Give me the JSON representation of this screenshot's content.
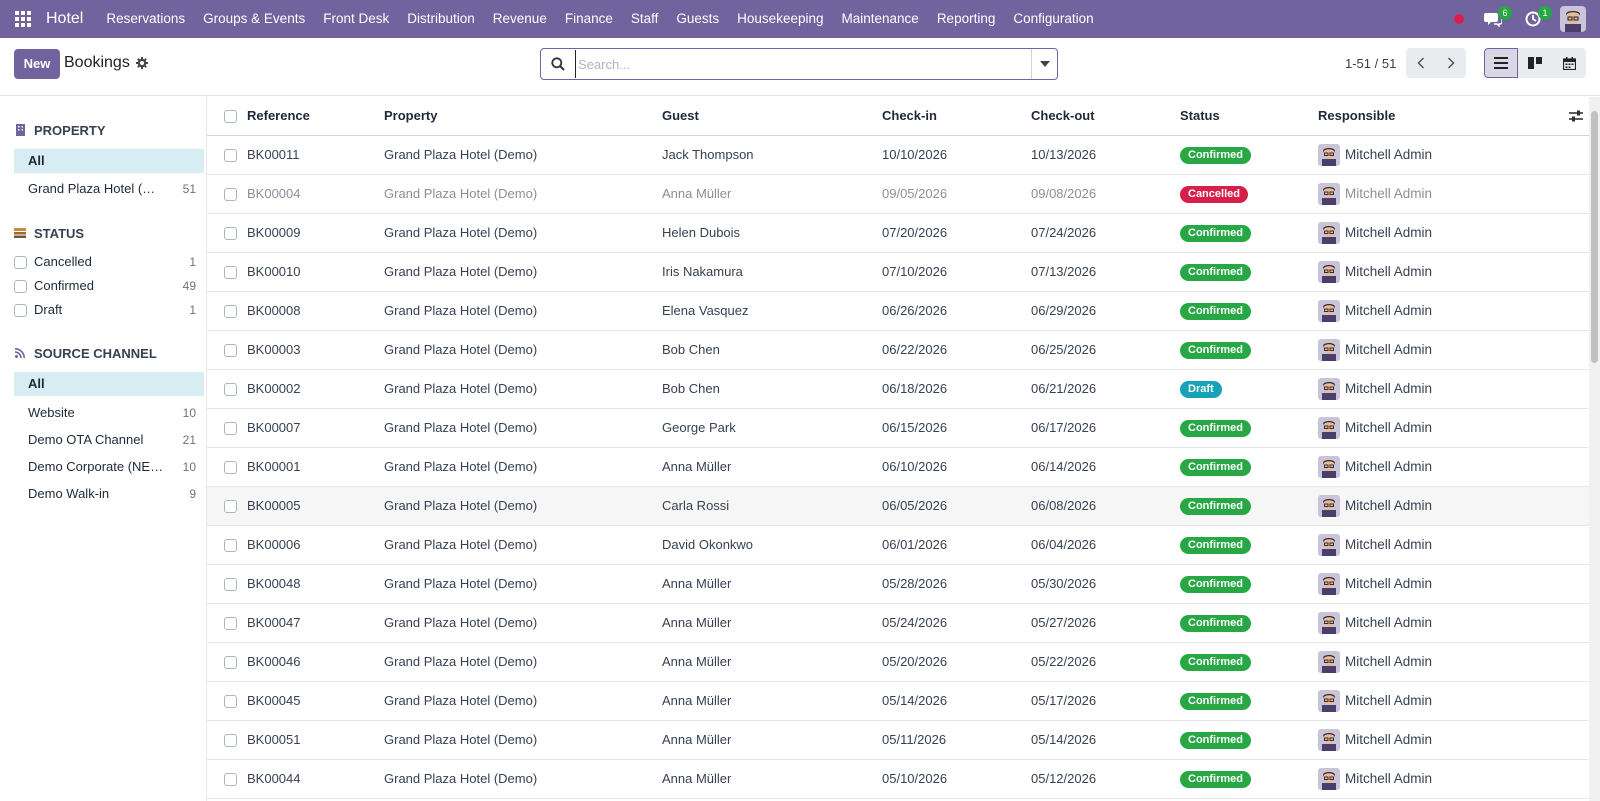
{
  "app": {
    "brand": "Hotel"
  },
  "nav": {
    "menu": [
      "Reservations",
      "Groups & Events",
      "Front Desk",
      "Distribution",
      "Revenue",
      "Finance",
      "Staff",
      "Guests",
      "Housekeeping",
      "Maintenance",
      "Reporting",
      "Configuration"
    ],
    "messages_count": "6",
    "activities_count": "1"
  },
  "control": {
    "new_label": "New",
    "title": "Bookings",
    "search_placeholder": "Search...",
    "pager": "1-51 / 51"
  },
  "sidebar": {
    "property": {
      "header": "PROPERTY",
      "items": [
        {
          "label": "All",
          "count": ""
        },
        {
          "label": "Grand Plaza Hotel (Demo)",
          "count": "51"
        }
      ]
    },
    "status": {
      "header": "STATUS",
      "items": [
        {
          "label": "Cancelled",
          "count": "1"
        },
        {
          "label": "Confirmed",
          "count": "49"
        },
        {
          "label": "Draft",
          "count": "1"
        }
      ]
    },
    "source": {
      "header": "SOURCE CHANNEL",
      "items": [
        {
          "label": "All",
          "count": ""
        },
        {
          "label": "Website",
          "count": "10"
        },
        {
          "label": "Demo OTA Channel",
          "count": "21"
        },
        {
          "label": "Demo Corporate (NEG)",
          "count": "10"
        },
        {
          "label": "Demo Walk-in",
          "count": "9"
        }
      ]
    }
  },
  "table": {
    "headers": {
      "reference": "Reference",
      "property": "Property",
      "guest": "Guest",
      "checkin": "Check-in",
      "checkout": "Check-out",
      "status": "Status",
      "responsible": "Responsible"
    },
    "rows": [
      {
        "ref": "BK00011",
        "property": "Grand Plaza Hotel (Demo)",
        "guest": "Jack Thompson",
        "checkin": "10/10/2026",
        "checkout": "10/13/2026",
        "status": "Confirmed",
        "responsible": "Mitchell Admin"
      },
      {
        "ref": "BK00004",
        "property": "Grand Plaza Hotel (Demo)",
        "guest": "Anna Müller",
        "checkin": "09/05/2026",
        "checkout": "09/08/2026",
        "status": "Cancelled",
        "responsible": "Mitchell Admin"
      },
      {
        "ref": "BK00009",
        "property": "Grand Plaza Hotel (Demo)",
        "guest": "Helen Dubois",
        "checkin": "07/20/2026",
        "checkout": "07/24/2026",
        "status": "Confirmed",
        "responsible": "Mitchell Admin"
      },
      {
        "ref": "BK00010",
        "property": "Grand Plaza Hotel (Demo)",
        "guest": "Iris Nakamura",
        "checkin": "07/10/2026",
        "checkout": "07/13/2026",
        "status": "Confirmed",
        "responsible": "Mitchell Admin"
      },
      {
        "ref": "BK00008",
        "property": "Grand Plaza Hotel (Demo)",
        "guest": "Elena Vasquez",
        "checkin": "06/26/2026",
        "checkout": "06/29/2026",
        "status": "Confirmed",
        "responsible": "Mitchell Admin"
      },
      {
        "ref": "BK00003",
        "property": "Grand Plaza Hotel (Demo)",
        "guest": "Bob Chen",
        "checkin": "06/22/2026",
        "checkout": "06/25/2026",
        "status": "Confirmed",
        "responsible": "Mitchell Admin"
      },
      {
        "ref": "BK00002",
        "property": "Grand Plaza Hotel (Demo)",
        "guest": "Bob Chen",
        "checkin": "06/18/2026",
        "checkout": "06/21/2026",
        "status": "Draft",
        "responsible": "Mitchell Admin"
      },
      {
        "ref": "BK00007",
        "property": "Grand Plaza Hotel (Demo)",
        "guest": "George Park",
        "checkin": "06/15/2026",
        "checkout": "06/17/2026",
        "status": "Confirmed",
        "responsible": "Mitchell Admin"
      },
      {
        "ref": "BK00001",
        "property": "Grand Plaza Hotel (Demo)",
        "guest": "Anna Müller",
        "checkin": "06/10/2026",
        "checkout": "06/14/2026",
        "status": "Confirmed",
        "responsible": "Mitchell Admin"
      },
      {
        "ref": "BK00005",
        "property": "Grand Plaza Hotel (Demo)",
        "guest": "Carla Rossi",
        "checkin": "06/05/2026",
        "checkout": "06/08/2026",
        "status": "Confirmed",
        "responsible": "Mitchell Admin"
      },
      {
        "ref": "BK00006",
        "property": "Grand Plaza Hotel (Demo)",
        "guest": "David Okonkwo",
        "checkin": "06/01/2026",
        "checkout": "06/04/2026",
        "status": "Confirmed",
        "responsible": "Mitchell Admin"
      },
      {
        "ref": "BK00048",
        "property": "Grand Plaza Hotel (Demo)",
        "guest": "Anna Müller",
        "checkin": "05/28/2026",
        "checkout": "05/30/2026",
        "status": "Confirmed",
        "responsible": "Mitchell Admin"
      },
      {
        "ref": "BK00047",
        "property": "Grand Plaza Hotel (Demo)",
        "guest": "Anna Müller",
        "checkin": "05/24/2026",
        "checkout": "05/27/2026",
        "status": "Confirmed",
        "responsible": "Mitchell Admin"
      },
      {
        "ref": "BK00046",
        "property": "Grand Plaza Hotel (Demo)",
        "guest": "Anna Müller",
        "checkin": "05/20/2026",
        "checkout": "05/22/2026",
        "status": "Confirmed",
        "responsible": "Mitchell Admin"
      },
      {
        "ref": "BK00045",
        "property": "Grand Plaza Hotel (Demo)",
        "guest": "Anna Müller",
        "checkin": "05/14/2026",
        "checkout": "05/17/2026",
        "status": "Confirmed",
        "responsible": "Mitchell Admin"
      },
      {
        "ref": "BK00051",
        "property": "Grand Plaza Hotel (Demo)",
        "guest": "Anna Müller",
        "checkin": "05/11/2026",
        "checkout": "05/14/2026",
        "status": "Confirmed",
        "responsible": "Mitchell Admin"
      },
      {
        "ref": "BK00044",
        "property": "Grand Plaza Hotel (Demo)",
        "guest": "Anna Müller",
        "checkin": "05/10/2026",
        "checkout": "05/12/2026",
        "status": "Confirmed",
        "responsible": "Mitchell Admin"
      }
    ]
  },
  "colors": {
    "brand": "#71639e",
    "confirmed": "#28a745",
    "cancelled": "#d6204b",
    "draft": "#17a2b8",
    "active_filter": "#d8ecf4"
  }
}
